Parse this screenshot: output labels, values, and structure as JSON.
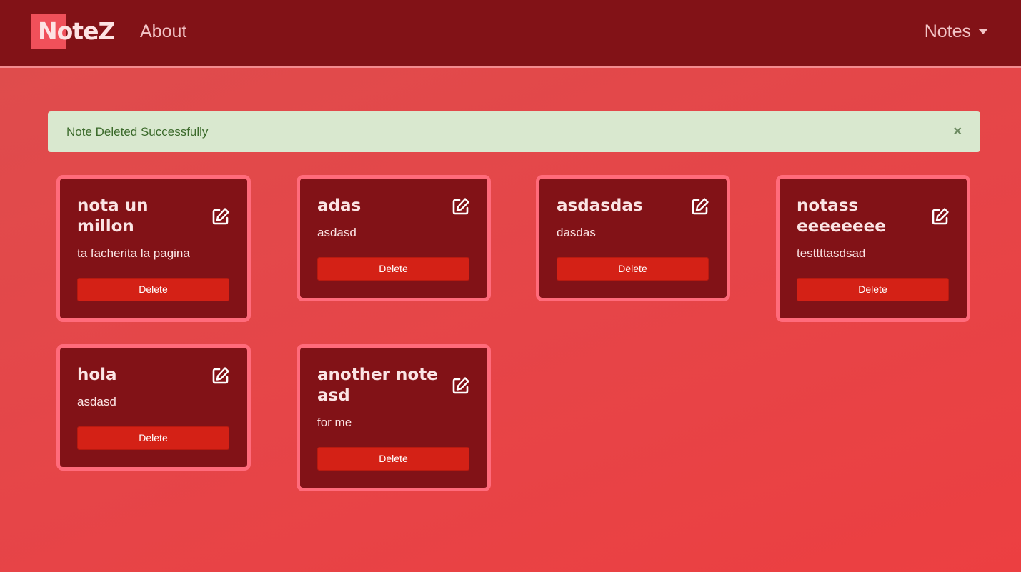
{
  "nav": {
    "brand": "NoteZ",
    "about": "About",
    "notes_menu": "Notes"
  },
  "alert": {
    "message": "Note Deleted Successfully",
    "close": "×"
  },
  "notes": [
    {
      "title": "nota un millon",
      "body": "ta facherita la pagina",
      "delete_label": "Delete"
    },
    {
      "title": "adas",
      "body": "asdasd",
      "delete_label": "Delete"
    },
    {
      "title": "asdasdas",
      "body": "dasdas",
      "delete_label": "Delete"
    },
    {
      "title": "notass eeeeeeee",
      "body": "testtttasdsad",
      "delete_label": "Delete"
    },
    {
      "title": "hola",
      "body": "asdasd",
      "delete_label": "Delete"
    },
    {
      "title": "another note asd",
      "body": "for me",
      "delete_label": "Delete"
    }
  ],
  "colors": {
    "navbar": "#821217",
    "card": "#821217",
    "card_border": "#ff6b7b",
    "delete_button": "#d42116",
    "alert_bg": "#d9e8cf"
  }
}
